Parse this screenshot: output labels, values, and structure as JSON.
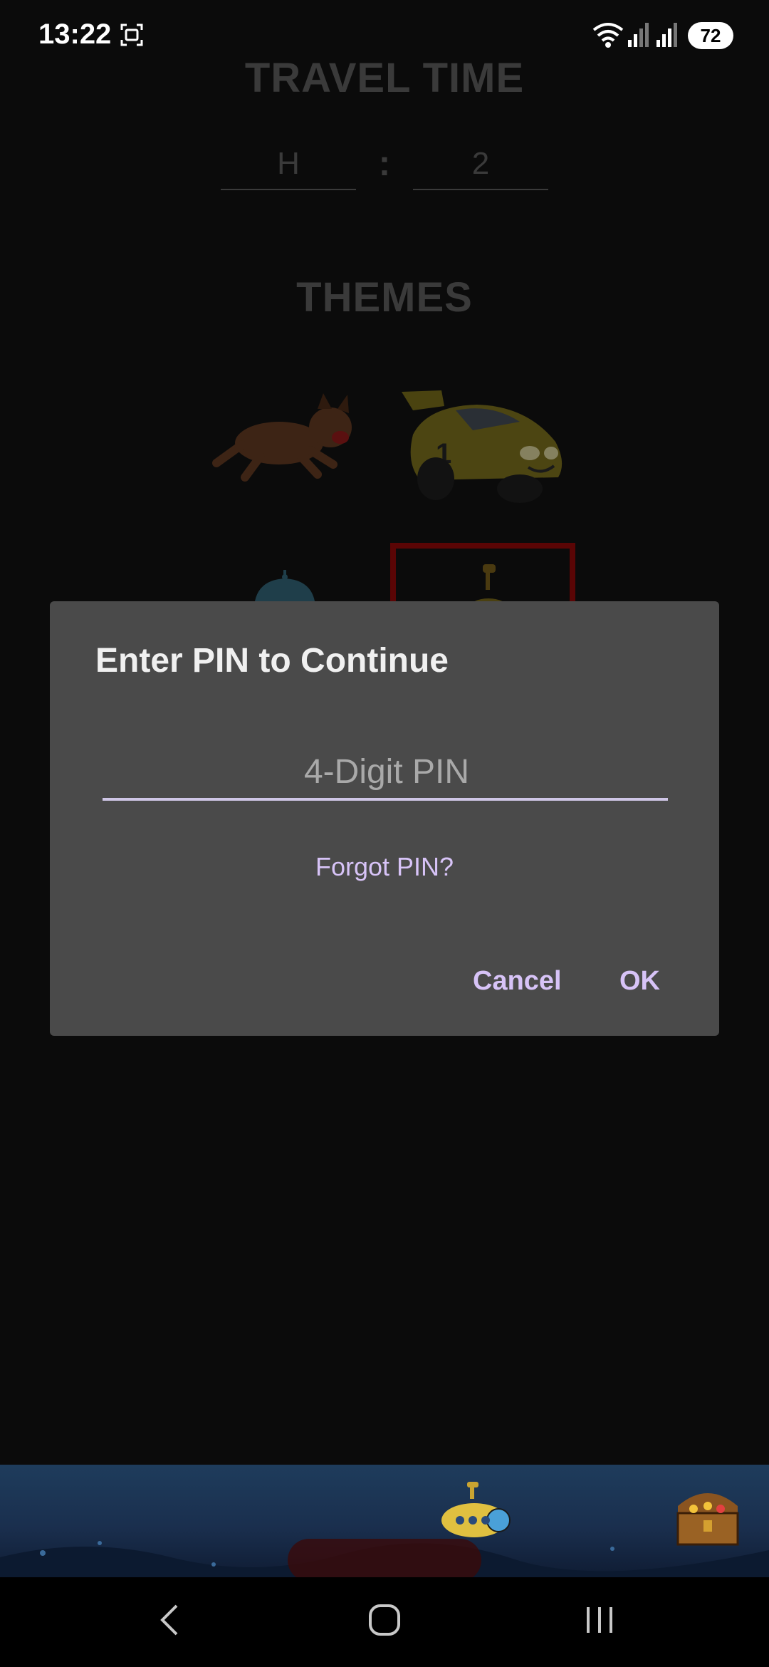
{
  "status_bar": {
    "time": "13:22",
    "battery": "72"
  },
  "app": {
    "travel_time_heading": "TRAVEL TIME",
    "hours_placeholder": "H",
    "colon": ":",
    "minutes_value": "2",
    "themes_heading": "THEMES"
  },
  "dialog": {
    "title": "Enter PIN to Continue",
    "pin_placeholder": "4-Digit PIN",
    "forgot_label": "Forgot PIN?",
    "cancel_label": "Cancel",
    "ok_label": "OK"
  },
  "icons": {
    "themes": [
      "dog-theme-icon",
      "race-car-theme-icon",
      "ufo-theme-icon",
      "submarine-theme-icon"
    ],
    "banner": [
      "submarine-icon",
      "treasure-chest-icon"
    ],
    "nav": [
      "back-icon",
      "home-icon",
      "recents-icon"
    ]
  },
  "colors": {
    "accent": "#d7c3f7",
    "dialog_bg": "#4a4a4a",
    "dim_bg": "#0b0b0b"
  }
}
